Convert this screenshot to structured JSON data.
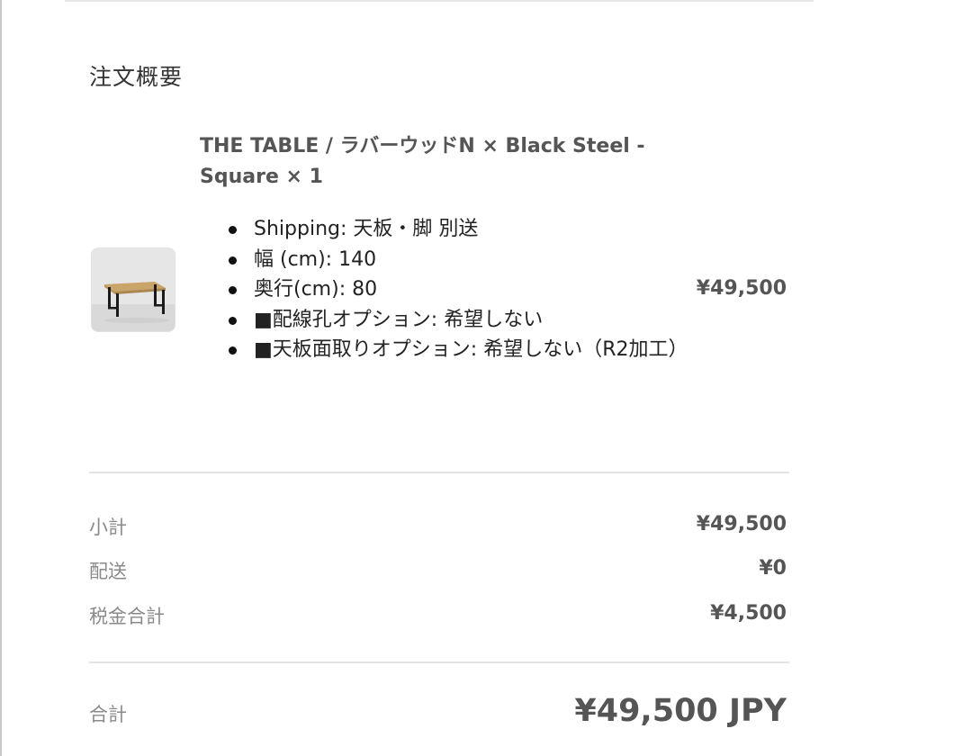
{
  "summary": {
    "title": "注文概要"
  },
  "line_item": {
    "image_icon": "table-product-thumbnail",
    "name": "THE TABLE / ラバーウッドN × Black Steel - Square × 1",
    "options": [
      "Shipping: 天板・脚 別送",
      "幅 (cm): 140",
      "奥行(cm): 80",
      "■配線孔オプション: 希望しない",
      "■天板面取りオプション: 希望しない（R2加工）"
    ],
    "price": "¥49,500"
  },
  "totals": {
    "subtotal_label": "小計",
    "subtotal_value": "¥49,500",
    "shipping_label": "配送",
    "shipping_value": "¥0",
    "tax_label": "税金合計",
    "tax_value": "¥4,500",
    "total_label": "合計",
    "total_value": "¥49,500 JPY"
  },
  "colors": {
    "text_primary": "#333333",
    "text_muted": "#8a8a8a",
    "price_text": "#555555",
    "divider": "#e3e3e3"
  }
}
